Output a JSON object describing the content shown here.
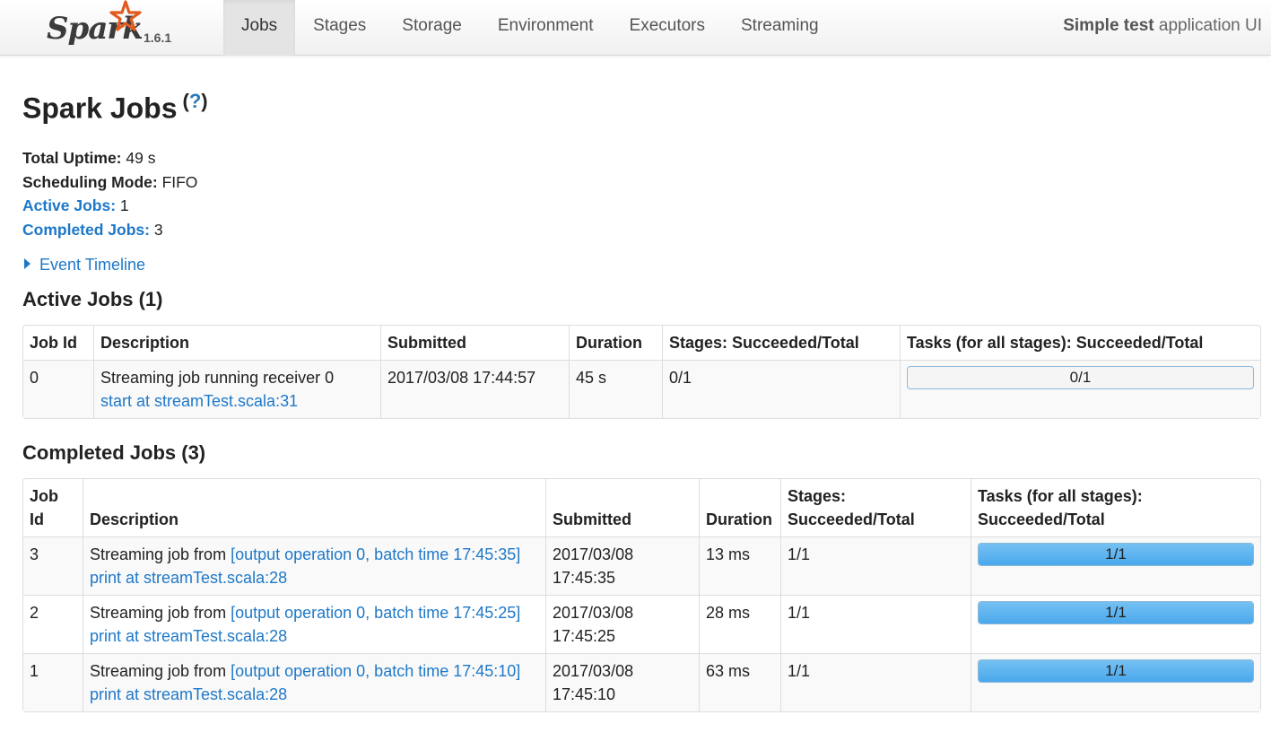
{
  "brand": {
    "name": "Spark",
    "version": "1.6.1"
  },
  "nav": {
    "tabs": [
      "Jobs",
      "Stages",
      "Storage",
      "Environment",
      "Executors",
      "Streaming"
    ],
    "active": "Jobs",
    "app_name_bold": "Simple test",
    "app_name_rest": " application UI"
  },
  "page": {
    "title": "Spark Jobs",
    "help_open": "(",
    "help_mark": "?",
    "help_close": ")"
  },
  "summary": {
    "uptime_label": "Total Uptime:",
    "uptime_value": " 49 s",
    "mode_label": "Scheduling Mode:",
    "mode_value": " FIFO",
    "active_label": "Active Jobs:",
    "active_value": " 1",
    "completed_label": "Completed Jobs:",
    "completed_value": " 3"
  },
  "timeline": {
    "label": "Event Timeline"
  },
  "active_jobs": {
    "heading": "Active Jobs (1)",
    "headers": [
      "Job Id",
      "Description",
      "Submitted",
      "Duration",
      "Stages: Succeeded/Total",
      "Tasks (for all stages): Succeeded/Total"
    ],
    "rows": [
      {
        "id": "0",
        "desc_text": "Streaming job running receiver 0",
        "desc_link": "start at streamTest.scala:31",
        "submitted": "2017/03/08 17:44:57",
        "duration": "45 s",
        "stages": "0/1",
        "tasks": "0/1",
        "progress": 0
      }
    ]
  },
  "completed_jobs": {
    "heading": "Completed Jobs (3)",
    "headers": {
      "id_1": "Job",
      "id_2": "Id",
      "desc": "Description",
      "submitted": "Submitted",
      "duration": "Duration",
      "stages_1": "Stages:",
      "stages_2": "Succeeded/Total",
      "tasks_1": "Tasks (for all stages):",
      "tasks_2": "Succeeded/Total"
    },
    "rows": [
      {
        "id": "3",
        "desc_prefix": "Streaming job from ",
        "desc_batch_link": "[output operation 0, batch time 17:45:35]",
        "desc_link": "print at streamTest.scala:28",
        "submitted_date": "2017/03/08",
        "submitted_time": "17:45:35",
        "duration": "13 ms",
        "stages": "1/1",
        "tasks": "1/1",
        "progress": 1
      },
      {
        "id": "2",
        "desc_prefix": "Streaming job from ",
        "desc_batch_link": "[output operation 0, batch time 17:45:25]",
        "desc_link": "print at streamTest.scala:28",
        "submitted_date": "2017/03/08",
        "submitted_time": "17:45:25",
        "duration": "28 ms",
        "stages": "1/1",
        "tasks": "1/1",
        "progress": 1
      },
      {
        "id": "1",
        "desc_prefix": "Streaming job from ",
        "desc_batch_link": "[output operation 0, batch time 17:45:10]",
        "desc_link": "print at streamTest.scala:28",
        "submitted_date": "2017/03/08",
        "submitted_time": "17:45:10",
        "duration": "63 ms",
        "stages": "1/1",
        "tasks": "1/1",
        "progress": 1
      }
    ]
  },
  "colors": {
    "link": "#1e78c8",
    "running_bar": "#a6e2f7",
    "done_bar": "#4aa8ec"
  }
}
